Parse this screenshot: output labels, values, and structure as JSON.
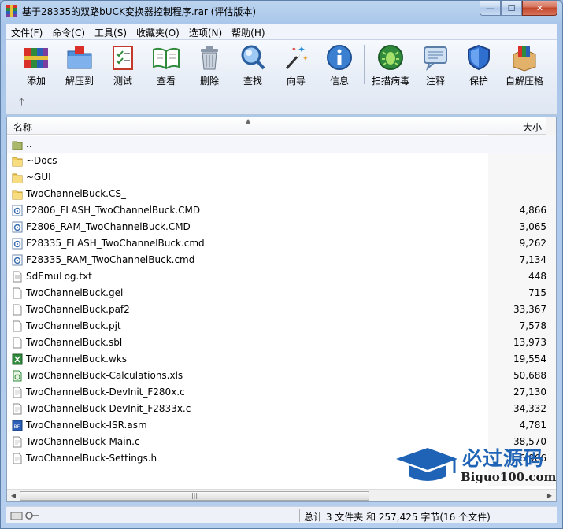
{
  "window": {
    "title": "基于28335的双路bUCK变换器控制程序.rar (评估版本)",
    "minimize": "—",
    "maximize": "☐",
    "close": "✕"
  },
  "menu": [
    "文件(F)",
    "命令(C)",
    "工具(S)",
    "收藏夹(O)",
    "选项(N)",
    "帮助(H)"
  ],
  "toolbar": {
    "add": "添加",
    "extract": "解压到",
    "test": "测试",
    "view": "查看",
    "delete": "删除",
    "find": "查找",
    "wizard": "向导",
    "info": "信息",
    "scan": "扫描病毒",
    "comment": "注释",
    "protect": "保护",
    "sfx": "自解压格"
  },
  "columns": {
    "name": "名称",
    "size": "大小"
  },
  "files": [
    {
      "name": "..",
      "size": "",
      "type": "parent"
    },
    {
      "name": "~Docs",
      "size": "",
      "type": "folder"
    },
    {
      "name": "~GUI",
      "size": "",
      "type": "folder"
    },
    {
      "name": "TwoChannelBuck.CS_",
      "size": "",
      "type": "folder"
    },
    {
      "name": "F2806_FLASH_TwoChannelBuck.CMD",
      "size": "4,866",
      "type": "cmd"
    },
    {
      "name": "F2806_RAM_TwoChannelBuck.CMD",
      "size": "3,065",
      "type": "cmd"
    },
    {
      "name": "F28335_FLASH_TwoChannelBuck.cmd",
      "size": "9,262",
      "type": "cmd"
    },
    {
      "name": "F28335_RAM_TwoChannelBuck.cmd",
      "size": "7,134",
      "type": "cmd"
    },
    {
      "name": "SdEmuLog.txt",
      "size": "448",
      "type": "txt"
    },
    {
      "name": "TwoChannelBuck.gel",
      "size": "715",
      "type": "file"
    },
    {
      "name": "TwoChannelBuck.paf2",
      "size": "33,367",
      "type": "file"
    },
    {
      "name": "TwoChannelBuck.pjt",
      "size": "7,578",
      "type": "file"
    },
    {
      "name": "TwoChannelBuck.sbl",
      "size": "13,973",
      "type": "file"
    },
    {
      "name": "TwoChannelBuck.wks",
      "size": "19,554",
      "type": "wks"
    },
    {
      "name": "TwoChannelBuck-Calculations.xls",
      "size": "50,688",
      "type": "xls"
    },
    {
      "name": "TwoChannelBuck-DevInit_F280x.c",
      "size": "27,130",
      "type": "c"
    },
    {
      "name": "TwoChannelBuck-DevInit_F2833x.c",
      "size": "34,332",
      "type": "c"
    },
    {
      "name": "TwoChannelBuck-ISR.asm",
      "size": "4,781",
      "type": "asm"
    },
    {
      "name": "TwoChannelBuck-Main.c",
      "size": "38,570",
      "type": "c"
    },
    {
      "name": "TwoChannelBuck-Settings.h",
      "size": "6,966",
      "type": "c"
    }
  ],
  "watermark": {
    "brand": "必过源码",
    "url": "Biguo100.com"
  },
  "status": {
    "summary": "总计 3 文件夹 和 257,425 字节(16 个文件)"
  }
}
